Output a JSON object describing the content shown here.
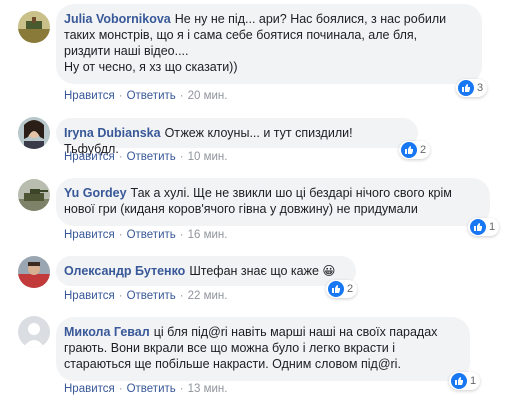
{
  "comments": [
    {
      "author": "Julia Vobornikova",
      "text": "Не ну не під... ари? Нас боялися, з нас робили\nтаких монстрів, що я і сама себе боятися починала, але бля,\npиздити наші відео....\nНу от чесно, я хз що сказати))",
      "reactions": "3",
      "like_label": "Нравится",
      "reply_label": "Ответить",
      "time": "20 мин."
    },
    {
      "author": "Iryna Dubianska",
      "text": "Отжеж клоуны... и тут спиздили! Тьфубдл.",
      "reactions": "2",
      "like_label": "Нравится",
      "reply_label": "Ответить",
      "time": "10 мин."
    },
    {
      "author": "Yu Gordey",
      "text": "Так а хулі. Ще не звикли шо ці бездарі нічого свого крім\nнової гри (киданя коров'ячого гівна у довжину) не придумали",
      "reactions": "1",
      "like_label": "Нравится",
      "reply_label": "Ответить",
      "time": "16 мин."
    },
    {
      "author": "Олександр Бутенко",
      "text": "Штефан знає що каже 😀",
      "reactions": "2",
      "like_label": "Нравится",
      "reply_label": "Ответить",
      "time": "22 мин."
    },
    {
      "author": "Микола Гевал",
      "text": "ці бля під@ri навіть марші наші на своїх парадах\nграють. Вони вкрали все що можна було і легко вкрасти і\nстараються ще побільше накрасти. Одним словом під@ri.",
      "reactions": "1",
      "like_label": "Нравится",
      "reply_label": "Ответить",
      "time": "13 мин."
    }
  ],
  "colors": {
    "author": "#385898",
    "bubble": "#f2f3f5",
    "like_blue": "#1877f2",
    "meta": "#90949c"
  }
}
